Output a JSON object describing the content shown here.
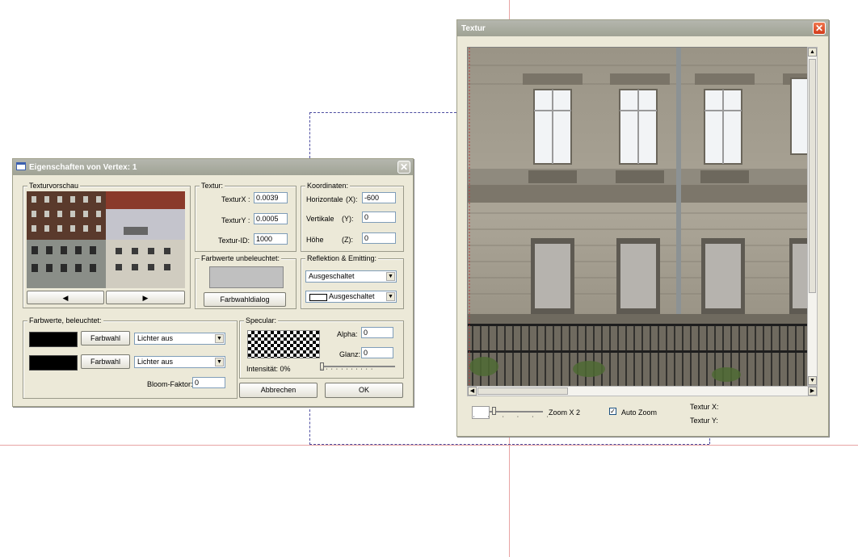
{
  "vertex_dialog": {
    "title": "Eigenschaften von Vertex: 1",
    "texture_preview": {
      "label": "Texturvorschau"
    },
    "texture": {
      "label": "Textur:",
      "textur_x_label": "TexturX :",
      "textur_x_value": "0.0039",
      "textur_y_label": "TexturY :",
      "textur_y_value": "0.0005",
      "textur_id_label": "Textur-ID:",
      "textur_id_value": "1000"
    },
    "coordinates": {
      "label": "Koordinaten:",
      "horizontal_label": "Horizontale",
      "horizontal_axis": "(X):",
      "horizontal_value": "-600",
      "vertical_label": "Vertikale",
      "vertical_axis": "(Y):",
      "vertical_value": "0",
      "height_label": "Höhe",
      "height_axis": "(Z):",
      "height_value": "0"
    },
    "unlit_colors": {
      "label": "Farbwerte unbeleuchtet:",
      "swatch_color": "#c0c0c0",
      "button": "Farbwahldialog"
    },
    "reflection": {
      "label": "Reflektion & Emitting:",
      "select1": "Ausgeschaltet",
      "select2": "Ausgeschaltet"
    },
    "lit_colors": {
      "label": "Farbwerte, beleuchtet:",
      "rows": [
        {
          "button": "Farbwahl",
          "select": "Lichter aus",
          "swatch_color": "#000000"
        },
        {
          "button": "Farbwahl",
          "select": "Lichter aus",
          "swatch_color": "#000000"
        }
      ],
      "bloom_label": "Bloom-Faktor:",
      "bloom_value": "0"
    },
    "specular": {
      "label": "Specular:",
      "alpha_label": "Alpha:",
      "alpha_value": "0",
      "glanz_label": "Glanz:",
      "glanz_value": "0",
      "intensity_label": "Intensität: 0%",
      "intensity_fraction": 0.0
    },
    "buttons": {
      "cancel": "Abbrechen",
      "ok": "OK"
    }
  },
  "texture_window": {
    "title": "Textur",
    "zoom_label": "Zoom X 2",
    "auto_zoom_label": "Auto Zoom",
    "auto_zoom_checked": true,
    "textur_x_label": "Textur X:",
    "textur_y_label": "Textur Y:"
  },
  "icons": {
    "window_icon": "window-icon",
    "close": "close-icon",
    "left_arrow": "left-arrow-icon",
    "right_arrow": "right-arrow-icon",
    "dropdown": "chevron-down-icon",
    "checkbox": "checkmark-icon"
  }
}
